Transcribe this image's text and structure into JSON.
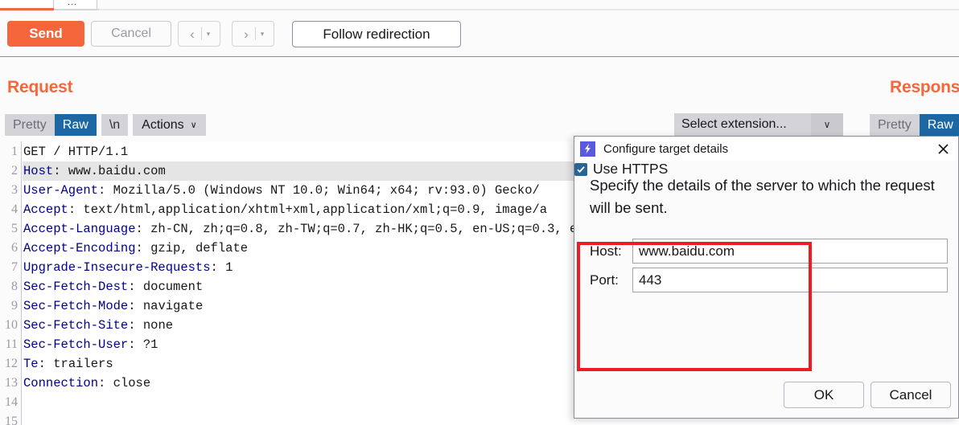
{
  "tabs": {
    "active_indicator": "",
    "overflow_label": "..."
  },
  "toolbar": {
    "send_label": "Send",
    "cancel_label": "Cancel",
    "prev_arrow": "‹",
    "prev_caret": "▾",
    "next_arrow": "›",
    "next_caret": "▾",
    "follow_redirection_label": "Follow redirection"
  },
  "request": {
    "title": "Request",
    "tabs": [
      {
        "label": "Pretty",
        "active": false
      },
      {
        "label": "Raw",
        "active": true
      }
    ],
    "newline_label": "\\n",
    "actions_label": "Actions",
    "actions_caret": "∨",
    "lines": [
      {
        "n": "1",
        "name": "",
        "value": "GET / HTTP/1.1"
      },
      {
        "n": "2",
        "name": "Host",
        "value": ": www.baidu.com",
        "highlight": true
      },
      {
        "n": "3",
        "name": "User-Agent",
        "value": ": Mozilla/5.0 (Windows NT 10.0; Win64; x64; rv:93.0) Gecko/"
      },
      {
        "n": "4",
        "name": "Accept",
        "value": ": text/html,application/xhtml+xml,application/xml;q=0.9, image/a"
      },
      {
        "n": "5",
        "name": "Accept-Language",
        "value": ": zh-CN, zh;q=0.8, zh-TW;q=0.7, zh-HK;q=0.5, en-US;q=0.3, e"
      },
      {
        "n": "6",
        "name": "Accept-Encoding",
        "value": ": gzip, deflate"
      },
      {
        "n": "7",
        "name": "Upgrade-Insecure-Requests",
        "value": ": 1"
      },
      {
        "n": "8",
        "name": "Sec-Fetch-Dest",
        "value": ": document"
      },
      {
        "n": "9",
        "name": "Sec-Fetch-Mode",
        "value": ": navigate"
      },
      {
        "n": "10",
        "name": "Sec-Fetch-Site",
        "value": ": none"
      },
      {
        "n": "11",
        "name": "Sec-Fetch-User",
        "value": ": ?1"
      },
      {
        "n": "12",
        "name": "Te",
        "value": ": trailers"
      },
      {
        "n": "13",
        "name": "Connection",
        "value": ": close"
      },
      {
        "n": "14",
        "name": "",
        "value": ""
      },
      {
        "n": "15",
        "name": "",
        "value": ""
      }
    ]
  },
  "extension_selector": {
    "label": "Select extension...",
    "caret": "∨"
  },
  "response": {
    "title": "Response",
    "tabs": [
      {
        "label": "Pretty",
        "active": false
      },
      {
        "label": "Raw",
        "active": true
      }
    ]
  },
  "dialog": {
    "title": "Configure target details",
    "icon": "burp-bolt-icon",
    "close_icon": "close-icon",
    "description": "Specify the details of the server to which the request will be sent.",
    "host_label": "Host:",
    "host_value": "www.baidu.com",
    "port_label": "Port:",
    "port_value": "443",
    "use_https_label": "Use HTTPS",
    "use_https_checked": true,
    "ok_label": "OK",
    "cancel_label": "Cancel"
  },
  "annotation": {
    "highlight_color": "#EC1C24"
  },
  "colors": {
    "accent_orange": "#F5663C",
    "tab_active_blue": "#1D67A5",
    "header_name_blue": "#00008F",
    "burp_icon_purple": "#5A5AE0",
    "checkbox_blue": "#2A6496"
  }
}
